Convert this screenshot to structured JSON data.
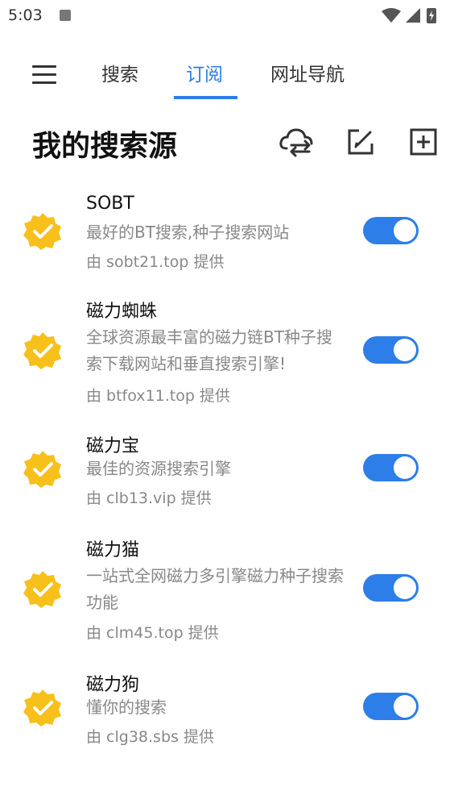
{
  "status_bar": {
    "time": "5:03"
  },
  "tabs": [
    {
      "label": "搜索"
    },
    {
      "label": "订阅",
      "active": true
    },
    {
      "label": "网址导航"
    }
  ],
  "page_title": "我的搜索源",
  "header_icons": [
    "cloud-sync-icon",
    "edit-icon",
    "add-box-icon"
  ],
  "colors": {
    "accent": "#2d7ee8",
    "badge": "#f7c01b",
    "toggle_on": "#2d7ee8"
  },
  "sources": [
    {
      "name": "SOBT",
      "desc": "最好的BT搜索,种子搜索网站",
      "provider": "由 sobt21.top 提供",
      "enabled": true
    },
    {
      "name": "磁力蜘蛛",
      "desc": "全球资源最丰富的磁力链BT种子搜索下载网站和垂直搜索引擎!",
      "provider": "由 btfox11.top 提供",
      "enabled": true
    },
    {
      "name": "磁力宝",
      "desc": "最佳的资源搜索引擎",
      "provider": "由 clb13.vip 提供",
      "enabled": true
    },
    {
      "name": "磁力猫",
      "desc": "一站式全网磁力多引擎磁力种子搜索功能",
      "provider": "由 clm45.top 提供",
      "enabled": true
    },
    {
      "name": "磁力狗",
      "desc": "懂你的搜索",
      "provider": "由 clg38.sbs 提供",
      "enabled": true
    }
  ]
}
